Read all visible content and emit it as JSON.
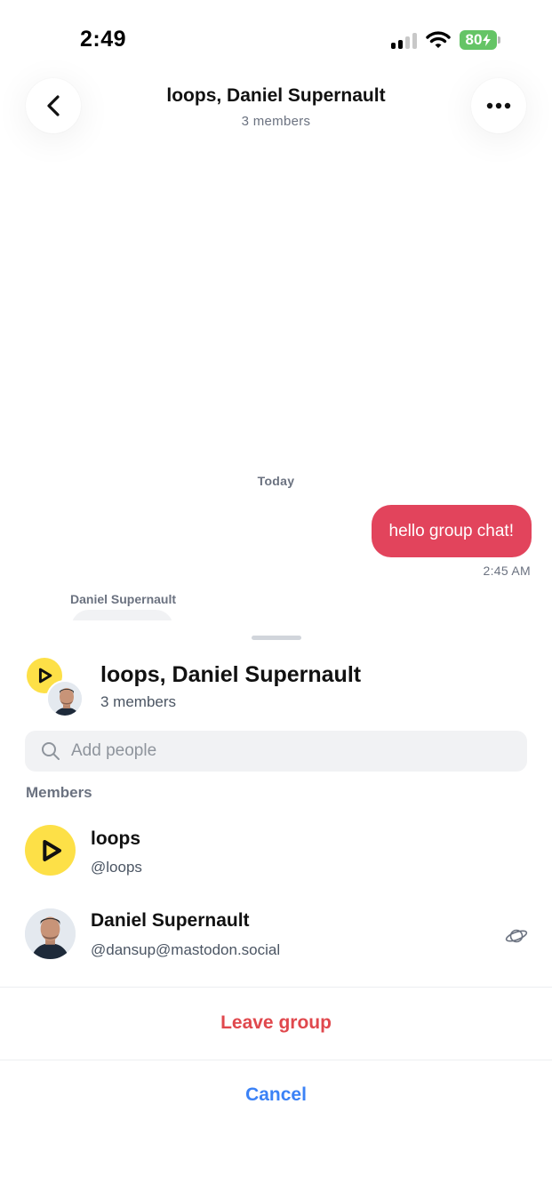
{
  "status_bar": {
    "time": "2:49",
    "battery": "80"
  },
  "chat_header": {
    "title": "loops, Daniel Supernault",
    "subtitle": "3 members"
  },
  "chat": {
    "date_separator": "Today",
    "messages": [
      {
        "direction": "outgoing",
        "text": "hello group chat!",
        "time": "2:45 AM"
      },
      {
        "direction": "incoming",
        "sender": "Daniel Supernault"
      }
    ]
  },
  "sheet": {
    "title": "loops, Daniel Supernault",
    "subtitle": "3 members",
    "search_placeholder": "Add people",
    "section_label": "Members",
    "members": [
      {
        "name": "loops",
        "handle": "@loops"
      },
      {
        "name": "Daniel Supernault",
        "handle": "@dansup@mastodon.social",
        "icon": "planet-icon"
      }
    ],
    "leave_label": "Leave group",
    "cancel_label": "Cancel"
  },
  "colors": {
    "outgoing_bubble": "#e2445c",
    "leave": "#e0484d",
    "cancel": "#3b82f6",
    "loops_yellow": "#fde047",
    "battery_green": "#65c466"
  }
}
